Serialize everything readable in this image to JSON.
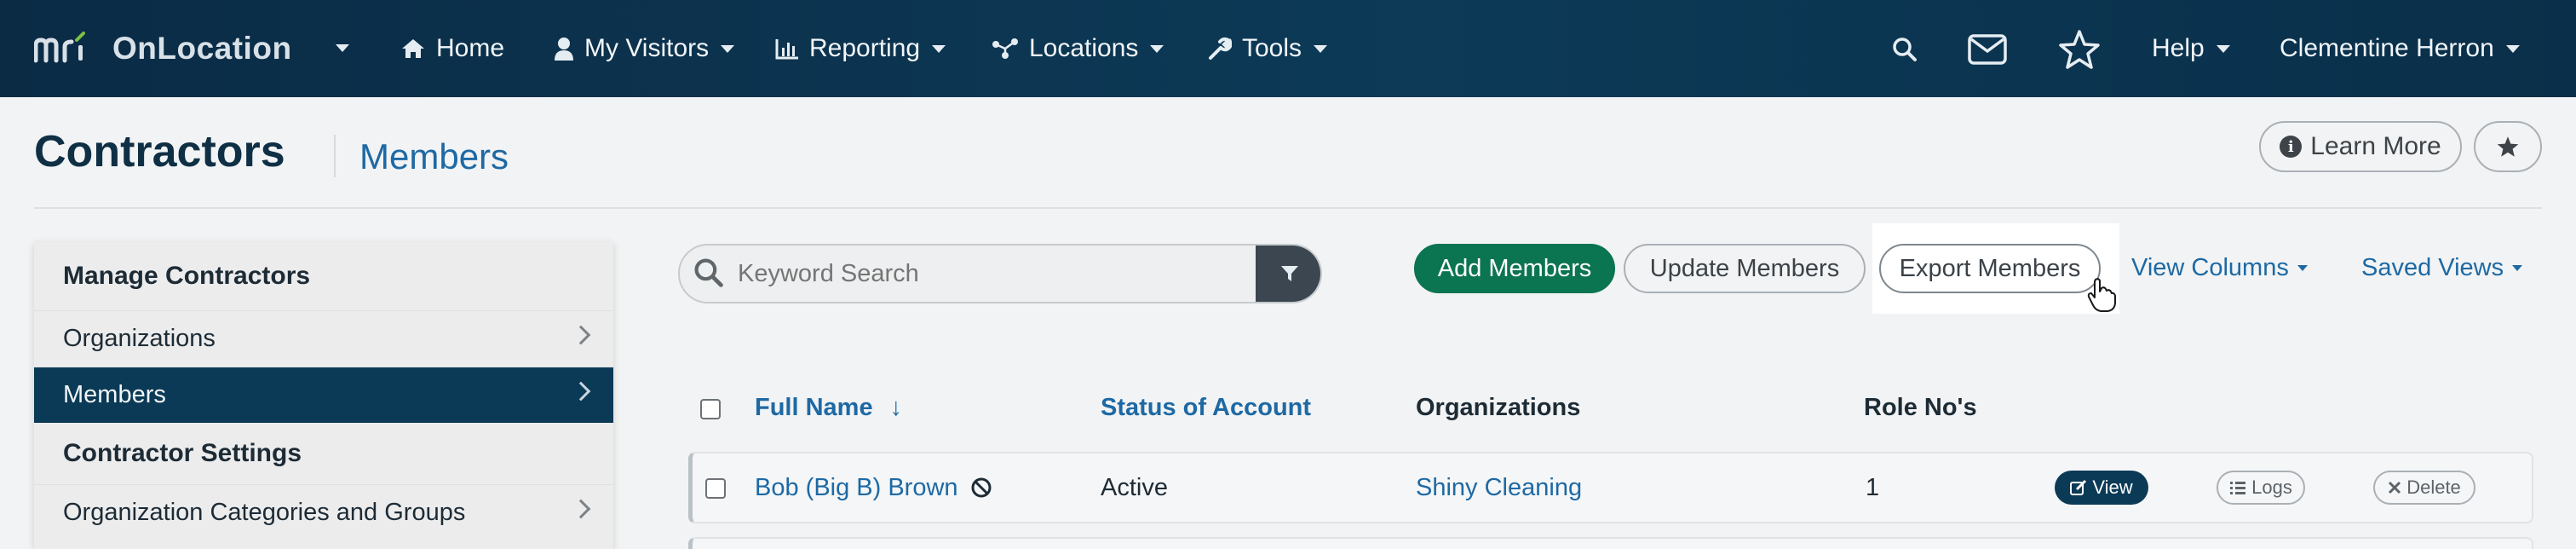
{
  "navbar": {
    "logo_mark": "mri",
    "product_name": "OnLocation",
    "items": [
      {
        "label": "Home",
        "icon": "home-icon"
      },
      {
        "label": "My Visitors",
        "icon": "user-icon"
      },
      {
        "label": "Reporting",
        "icon": "bar-chart-icon"
      },
      {
        "label": "Locations",
        "icon": "network-icon"
      },
      {
        "label": "Tools",
        "icon": "wrench-icon"
      }
    ],
    "help_label": "Help",
    "user_name": "Clementine Herron"
  },
  "header": {
    "title": "Contractors",
    "subtitle": "Members",
    "learn_more_label": "Learn More"
  },
  "sidebar": {
    "sections": [
      {
        "heading": "Manage Contractors",
        "items": [
          {
            "label": "Organizations",
            "active": false
          },
          {
            "label": "Members",
            "active": true
          }
        ]
      },
      {
        "heading": "Contractor Settings",
        "items": [
          {
            "label": "Organization Categories and Groups",
            "active": false
          }
        ]
      }
    ]
  },
  "toolbar": {
    "search_placeholder": "Keyword Search",
    "add_label": "Add Members",
    "update_label": "Update Members",
    "export_label": "Export Members",
    "view_columns_label": "View Columns",
    "saved_views_label": "Saved Views"
  },
  "table": {
    "columns": [
      "Full Name",
      "Status of Account",
      "Organizations",
      "Role No's"
    ],
    "sort_indicator": "↓",
    "rows": [
      {
        "full_name": "Bob (Big B) Brown",
        "status": "Active",
        "organization": "Shiny Cleaning",
        "role_no": "1",
        "actions": {
          "view": "View",
          "logs": "Logs",
          "delete": "Delete"
        }
      }
    ]
  },
  "colors": {
    "navbar": "#0b2b45",
    "accent_green": "#0b7450",
    "link_blue": "#1d69a4",
    "active_sidebar": "#0b3a56"
  }
}
